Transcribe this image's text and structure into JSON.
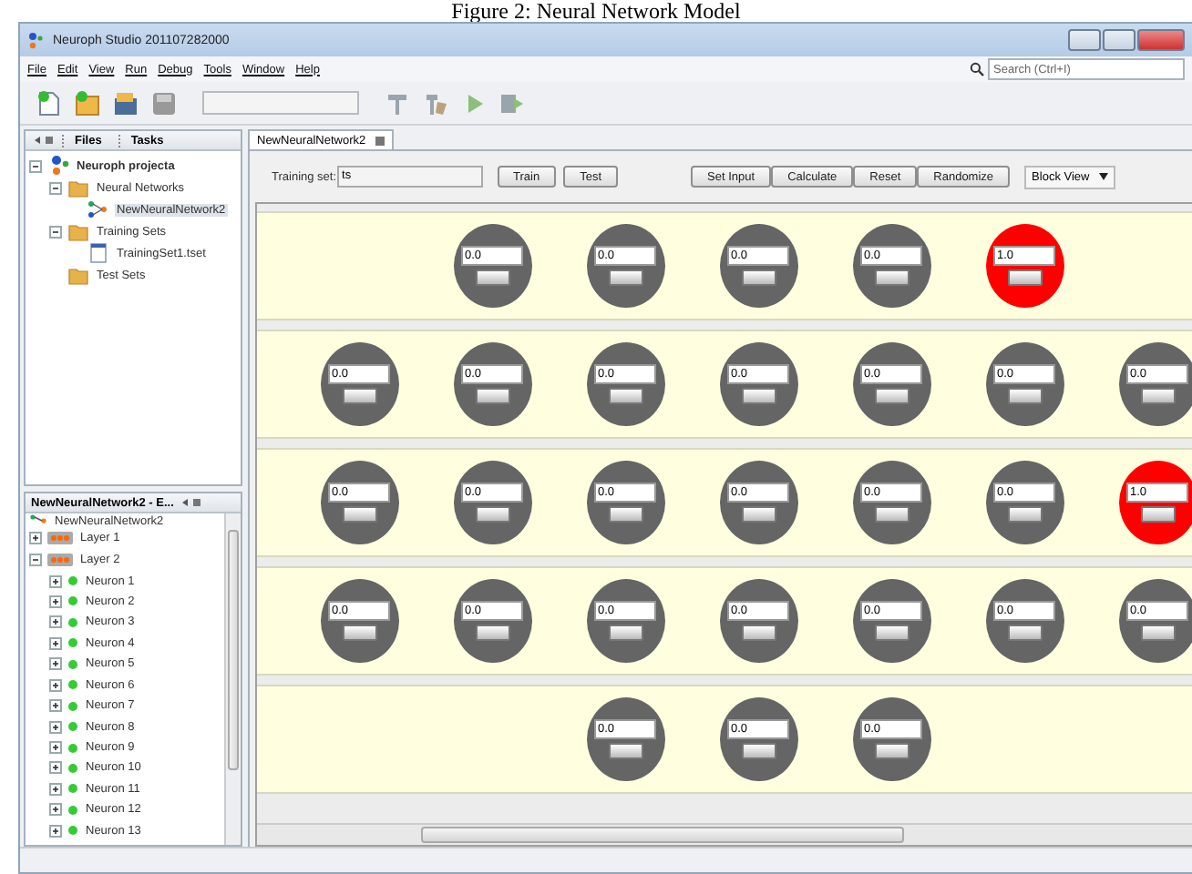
{
  "caption": "Figure 2: Neural Network Model",
  "window": {
    "title": "Neuroph Studio 201107282000"
  },
  "menu": [
    "File",
    "Edit",
    "View",
    "Run",
    "Debug",
    "Tools",
    "Window",
    "Help"
  ],
  "search": {
    "placeholder": "Search (Ctrl+I)"
  },
  "projects_panel": {
    "tabs": [
      {
        "label": "Files",
        "selected": false
      },
      {
        "label": "Tasks",
        "selected": false
      }
    ],
    "tree": [
      {
        "label": "Neuroph projecta",
        "kind": "project",
        "expanded": true,
        "children": [
          {
            "label": "Neural Networks",
            "kind": "folder",
            "expanded": true,
            "children": [
              {
                "label": "NewNeuralNetwork2",
                "kind": "network",
                "selected": true
              }
            ]
          },
          {
            "label": "Training Sets",
            "kind": "folder",
            "expanded": true,
            "children": [
              {
                "label": "TrainingSet1.tset",
                "kind": "file",
                "selected": false
              }
            ]
          },
          {
            "label": "Test Sets",
            "kind": "folder"
          }
        ]
      }
    ]
  },
  "navigator": {
    "title": "NewNeuralNetwork2 - E...",
    "root": "NewNeuralNetwork2",
    "layers": [
      {
        "label": "Layer 1",
        "expanded": false
      },
      {
        "label": "Layer 2",
        "expanded": true,
        "children": [
          {
            "label": "Neuron 1"
          },
          {
            "label": "Neuron 2"
          },
          {
            "label": "Neuron 3"
          },
          {
            "label": "Neuron 4"
          },
          {
            "label": "Neuron 5"
          },
          {
            "label": "Neuron 6"
          },
          {
            "label": "Neuron 7"
          },
          {
            "label": "Neuron 8"
          },
          {
            "label": "Neuron 9"
          },
          {
            "label": "Neuron 10"
          },
          {
            "label": "Neuron 11"
          },
          {
            "label": "Neuron 12"
          },
          {
            "label": "Neuron 13"
          }
        ]
      }
    ]
  },
  "editor": {
    "tab": "NewNeuralNetwork2",
    "training_set": {
      "label": "Training set:",
      "value": "ts"
    },
    "buttons": [
      "Train",
      "Test"
    ],
    "actions": [
      "Set Input",
      "Calculate",
      "Reset",
      "Randomize"
    ],
    "view": "Block View",
    "layers": [
      {
        "neurons": [
          {
            "value": "0.0",
            "active": false
          },
          {
            "value": "0.0",
            "active": false
          },
          {
            "value": "0.0",
            "active": false
          },
          {
            "value": "0.0",
            "active": false
          },
          {
            "value": "1.0",
            "active": true
          }
        ]
      },
      {
        "neurons": [
          {
            "value": "0.0",
            "active": false
          },
          {
            "value": "0.0",
            "active": false
          },
          {
            "value": "0.0",
            "active": false
          },
          {
            "value": "0.0",
            "active": false
          },
          {
            "value": "0.0",
            "active": false
          },
          {
            "value": "0.0",
            "active": false
          },
          {
            "value": "0.0",
            "active": false
          }
        ]
      },
      {
        "neurons": [
          {
            "value": "0.0",
            "active": false
          },
          {
            "value": "0.0",
            "active": false
          },
          {
            "value": "0.0",
            "active": false
          },
          {
            "value": "0.0",
            "active": false
          },
          {
            "value": "0.0",
            "active": false
          },
          {
            "value": "0.0",
            "active": false
          },
          {
            "value": "1.0",
            "active": true
          }
        ]
      },
      {
        "neurons": [
          {
            "value": "0.0",
            "active": false
          },
          {
            "value": "0.0",
            "active": false
          },
          {
            "value": "0.0",
            "active": false
          },
          {
            "value": "0.0",
            "active": false
          },
          {
            "value": "0.0",
            "active": false
          },
          {
            "value": "0.0",
            "active": false
          },
          {
            "value": "0.0",
            "active": false
          }
        ]
      },
      {
        "neurons": [
          {
            "value": "0.0",
            "active": false
          },
          {
            "value": "0.0",
            "active": false
          },
          {
            "value": "0.0",
            "active": false
          }
        ]
      }
    ]
  }
}
